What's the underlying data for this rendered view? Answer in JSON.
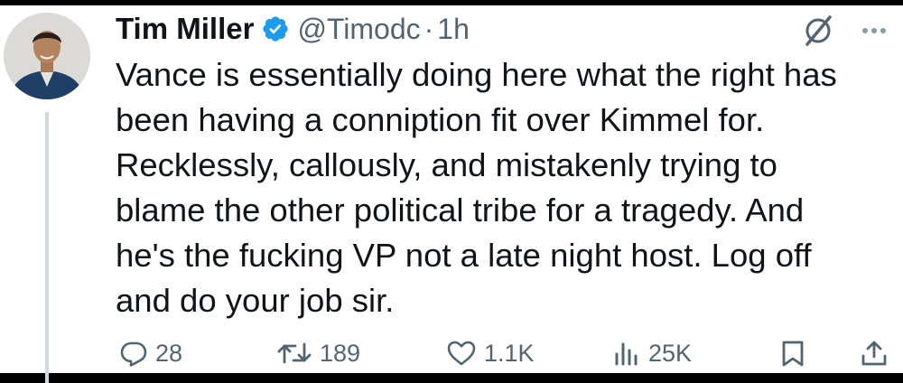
{
  "tweet": {
    "author_name": "Tim Miller",
    "handle": "@Timodc",
    "separator": "·",
    "time": "1h",
    "body_lines": [
      "Vance is essentially doing here what the right has",
      "been having a conniption fit over Kimmel for.",
      "Recklessly, callously, and mistakenly trying to",
      "blame the other political tribe for a tragedy. And",
      "he's the fucking VP not a late night host. Log off",
      "and do your job sir."
    ]
  },
  "actions": {
    "replies": "28",
    "retweets": "189",
    "likes": "1.1K",
    "views": "25K"
  },
  "icons": {
    "verified": "verified-badge-icon",
    "grok": "grok-icon",
    "more": "more-icon",
    "reply": "reply-icon",
    "retweet": "retweet-icon",
    "like": "heart-icon",
    "views": "views-icon",
    "bookmark": "bookmark-icon",
    "share": "share-icon"
  },
  "colors": {
    "verified_blue": "#1d9bf0",
    "text_primary": "#0f1419",
    "text_secondary": "#536471"
  }
}
